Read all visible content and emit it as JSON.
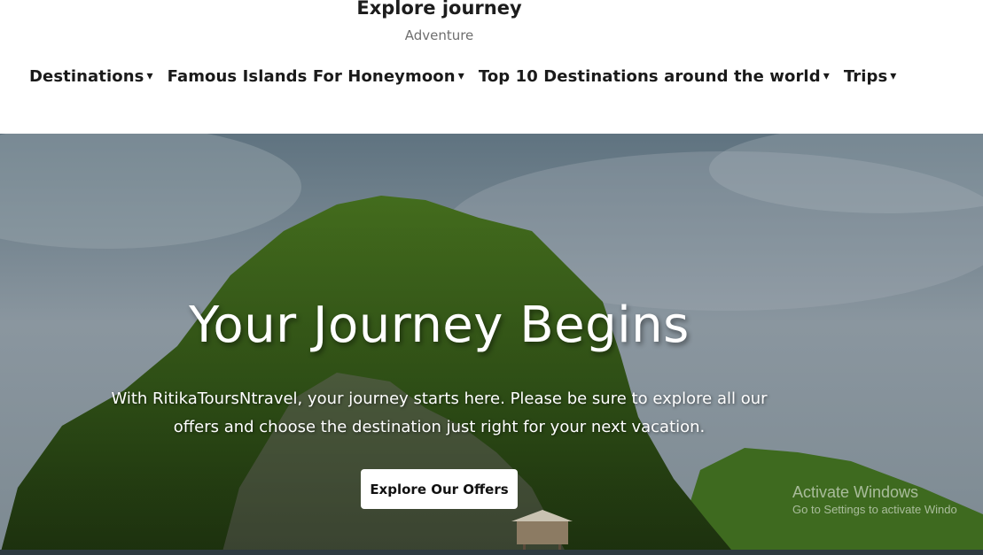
{
  "site": {
    "title": "Explore journey",
    "tagline": "Adventure"
  },
  "nav": {
    "items": [
      {
        "label": "Destinations",
        "caret": "▾"
      },
      {
        "label": "Famous Islands For Honeymoon",
        "caret": "▾"
      },
      {
        "label": "Top 10 Destinations around the world",
        "caret": "▾"
      },
      {
        "label": "Trips",
        "caret": "▾"
      }
    ]
  },
  "hero": {
    "title": "Your Journey Begins",
    "text_line1": "With RitikaToursNtravel, your journey starts here. Please be sure to explore all our",
    "text_line2": "offers and choose the destination just right for your next vacation.",
    "cta_label": "Explore Our Offers",
    "image_subject": "tropical-island-mountain"
  },
  "watermark": {
    "title": "Activate Windows",
    "subtitle": "Go to Settings to activate Windo"
  },
  "colors": {
    "nav_text": "#1a1a1a",
    "tagline": "#6f6f6f",
    "hero_text": "#ffffff",
    "button_bg": "#ffffff"
  }
}
